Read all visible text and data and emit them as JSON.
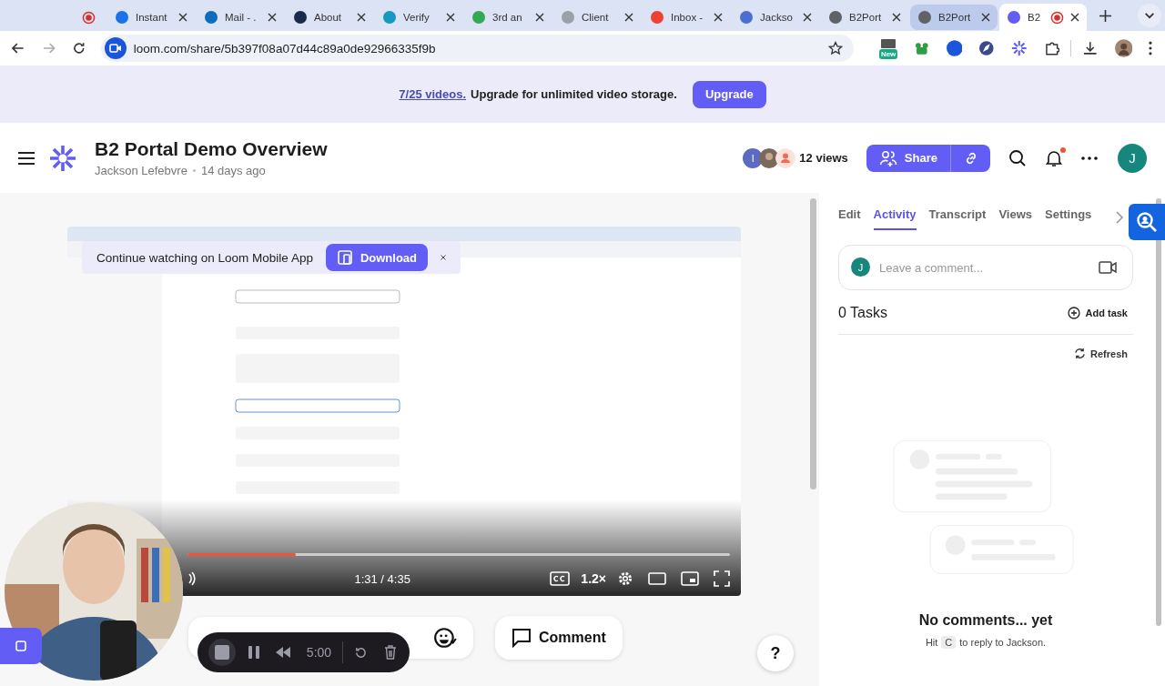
{
  "browser": {
    "tabs": [
      {
        "kind": "indicator",
        "recording": true,
        "selected": false,
        "hovered": false
      },
      {
        "kind": "page",
        "title": "Instant",
        "color": "#1a73e8",
        "recording": false,
        "selected": false,
        "hovered": false
      },
      {
        "kind": "page",
        "title": "Mail - .",
        "color": "#0f6cbd",
        "recording": false,
        "selected": false,
        "hovered": false
      },
      {
        "kind": "page",
        "title": "About",
        "color": "#1b2a4a",
        "recording": false,
        "selected": false,
        "hovered": false
      },
      {
        "kind": "page",
        "title": "Verify",
        "color": "#1798c1",
        "recording": false,
        "selected": false,
        "hovered": false
      },
      {
        "kind": "page",
        "title": "3rd an",
        "color": "#34a853",
        "recording": false,
        "selected": false,
        "hovered": false
      },
      {
        "kind": "page",
        "title": "Client",
        "color": "#9aa0a6",
        "recording": false,
        "selected": false,
        "hovered": false
      },
      {
        "kind": "page",
        "title": "Inbox -",
        "color": "#ea4335",
        "recording": false,
        "selected": false,
        "hovered": false
      },
      {
        "kind": "page",
        "title": "Jackso",
        "color": "#4a6fd1",
        "recording": false,
        "selected": false,
        "hovered": false
      },
      {
        "kind": "page",
        "title": "B2Port",
        "color": "#5f6368",
        "recording": false,
        "selected": false,
        "hovered": false
      },
      {
        "kind": "page",
        "title": "B2Port",
        "color": "#5f6368",
        "recording": false,
        "selected": false,
        "hovered": true
      },
      {
        "kind": "page",
        "title": "B2",
        "color": "#625df5",
        "recording": true,
        "selected": true,
        "hovered": false
      }
    ],
    "address": "loom.com/share/5b397f08a07d44c89a0de92966335f9b",
    "extension_badge": "New"
  },
  "banner": {
    "link": "7/25 videos.",
    "text": "Upgrade for unlimited video storage.",
    "button": "Upgrade"
  },
  "header": {
    "title": "B2 Portal Demo Overview",
    "author": "Jackson Lefebvre",
    "age": "14 days ago",
    "viewer_initial": "I",
    "views": "12 views",
    "share": "Share",
    "unread_notifications": true,
    "avatar": "J"
  },
  "video": {
    "kind": "picture",
    "toast": {
      "text": "Continue watching on Loom Mobile App",
      "button": "Download"
    },
    "progress": {
      "level": 0.2
    },
    "time": "1:31 / 4:35",
    "speed": "1.2×"
  },
  "actions": {
    "comment": "Comment"
  },
  "recorder": {
    "time": "5:00"
  },
  "help": "?",
  "panel": {
    "tabs": [
      {
        "label": "Edit",
        "selected": false
      },
      {
        "label": "Activity",
        "selected": true
      },
      {
        "label": "Transcript",
        "selected": false
      },
      {
        "label": "Views",
        "selected": false
      },
      {
        "label": "Settings",
        "selected": false
      }
    ],
    "comment": {
      "avatar": "J",
      "placeholder": "Leave a comment..."
    },
    "tasks": "0 Tasks",
    "add_task": "Add task",
    "refresh": "Refresh",
    "empty": {
      "title": "No comments... yet",
      "hint_before": "Hit",
      "hint_key": "C",
      "hint_after": "to reply to Jackson."
    }
  }
}
